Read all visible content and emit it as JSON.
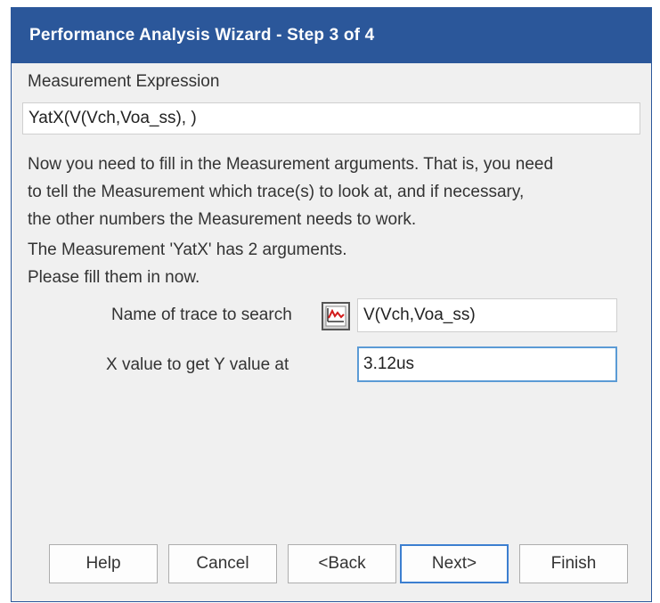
{
  "window": {
    "title": "Performance Analysis Wizard - Step 3 of 4"
  },
  "expression": {
    "label": "Measurement Expression",
    "value": "YatX(V(Vch,Voa_ss), )"
  },
  "instructions": [
    "Now you need to fill in the Measurement arguments.  That is, you need",
    "to tell the Measurement which trace(s) to look at, and if necessary,",
    "the other numbers the Measurement needs to work."
  ],
  "args_info": [
    "The Measurement 'YatX' has 2 arguments.",
    "Please fill them in now."
  ],
  "fields": {
    "trace": {
      "label": "Name of trace to search",
      "value": "V(Vch,Voa_ss)",
      "icon": "trace-browse-icon"
    },
    "xvalue": {
      "label": "X value to get Y value at",
      "value": "3.12us"
    }
  },
  "buttons": {
    "help": "Help",
    "cancel": "Cancel",
    "back": "<Back",
    "next": "Next>",
    "finish": "Finish"
  },
  "colors": {
    "titlebar": "#2b579a",
    "focus_border": "#5b9bd5",
    "default_button_border": "#3c7fd0"
  }
}
